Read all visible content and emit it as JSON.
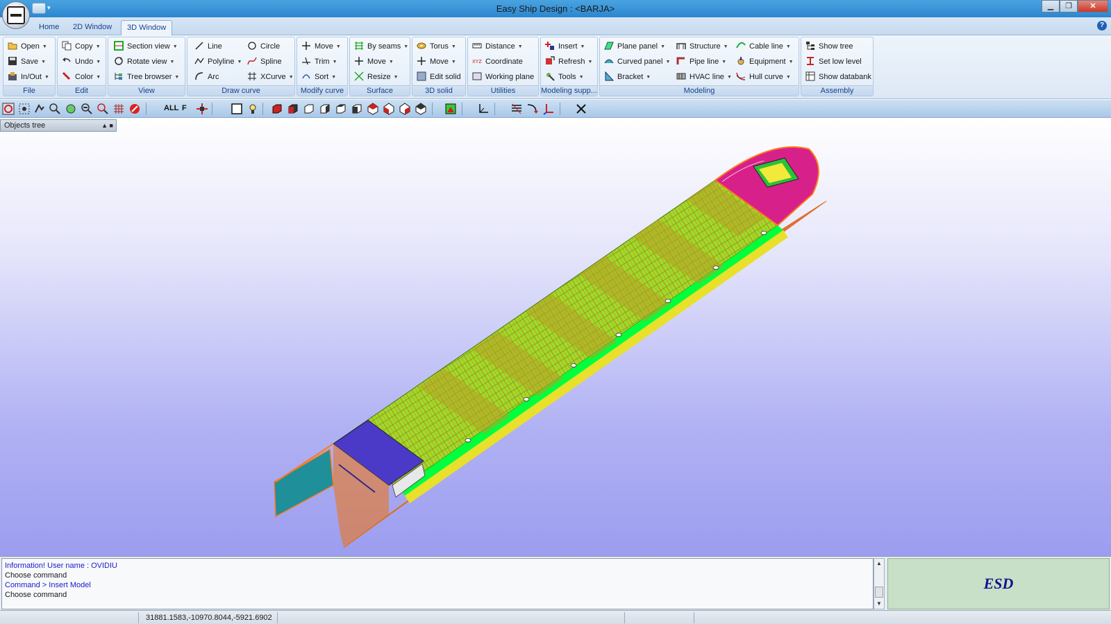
{
  "window": {
    "title": "Easy Ship Design : <BARJA>",
    "minimize": "▁",
    "restore": "❐",
    "close": "✕"
  },
  "tabs": [
    {
      "label": "Home"
    },
    {
      "label": "2D Window"
    },
    {
      "label": "3D Window"
    }
  ],
  "active_tab": "3D Window",
  "help": "?",
  "ribbon": {
    "file": {
      "label": "File",
      "open": "Open",
      "save": "Save",
      "inout": "In/Out"
    },
    "edit": {
      "label": "Edit",
      "copy": "Copy",
      "undo": "Undo",
      "color": "Color"
    },
    "view": {
      "label": "View",
      "section_view": "Section view",
      "rotate_view": "Rotate view",
      "tree_browser": "Tree browser"
    },
    "draw_curve": {
      "label": "Draw curve",
      "line": "Line",
      "polyline": "Polyline",
      "arc": "Arc",
      "circle": "Circle",
      "spline": "Spline",
      "xcurve": "XCurve"
    },
    "modify_curve": {
      "label": "Modify curve",
      "move": "Move",
      "trim": "Trim",
      "sort": "Sort"
    },
    "surface": {
      "label": "Surface",
      "by_seams": "By seams",
      "move": "Move",
      "resize": "Resize"
    },
    "solid": {
      "label": "3D solid",
      "torus": "Torus",
      "move": "Move",
      "edit_solid": "Edit solid"
    },
    "utilities": {
      "label": "Utilities",
      "distance": "Distance",
      "coordinate": "Coordinate",
      "working_plane": "Working plane"
    },
    "modeling_supp": {
      "label": "Modeling supp...",
      "insert": "Insert",
      "refresh": "Refresh",
      "tools": "Tools"
    },
    "modeling": {
      "label": "Modeling",
      "plane_panel": "Plane panel",
      "curved_panel": "Curved panel",
      "bracket": "Bracket",
      "structure": "Structure",
      "pipe_line": "Pipe line",
      "hvac_line": "HVAC line",
      "cable_line": "Cable line",
      "equipment": "Equipment",
      "hull_curve": "Hull curve"
    },
    "assembly": {
      "label": "Assembly",
      "show_tree": "Show  tree",
      "set_low_level": "Set low level",
      "show_databank": "Show databank"
    }
  },
  "toolstrip": {
    "all": "ALL",
    "f": "F"
  },
  "objects_tree": {
    "label": "Objects tree",
    "controls": "▲ ■"
  },
  "console": {
    "lines": [
      "Information! User name : OVIDIU",
      "Choose command",
      "Command > Insert Model",
      "Choose command"
    ],
    "brand": "ESD"
  },
  "status": {
    "coordinates": "31881.1583,-10970.8044,-5921.6902"
  },
  "colors": {
    "titlebar": "#2b86cf",
    "hull_green": "#9edb2a",
    "deck_bright": "#00ff3c",
    "hull_edge": "#ff7a1a",
    "bow_magenta": "#d8208a",
    "viewport_bottom": "#9c9def",
    "esd_bg": "#c8e0c8",
    "esd_text": "#14148a"
  }
}
